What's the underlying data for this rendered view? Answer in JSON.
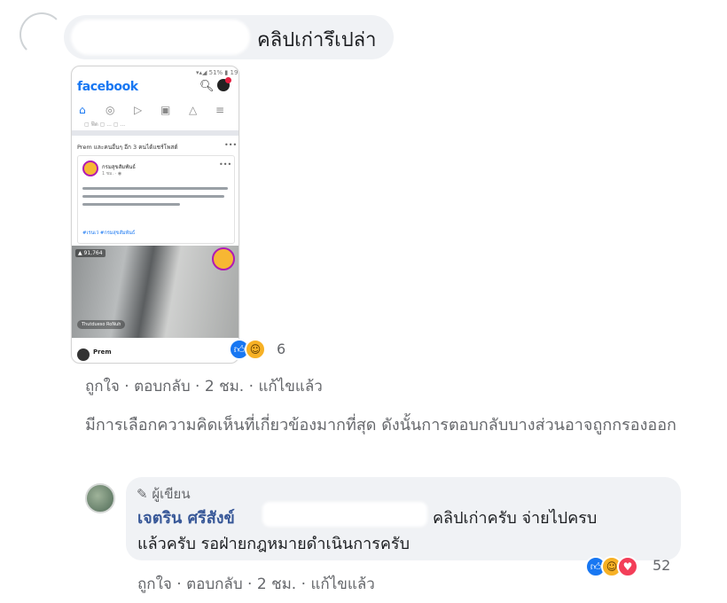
{
  "comment1": {
    "text": "คลิปเก่ารึเปล่า",
    "screenshot": {
      "status": "▾▴◢ 51% ▮ 19",
      "logo": "facebook",
      "sub_text": "▢ ฟีด ▢ ...   ▢ ...",
      "prem_line": "Prem และคนอื่นๆ อีก 3 คนได้แชร์โพสต์",
      "post_name": "กรมสุขสัมพันธ์",
      "post_time": "1 ชม. · ◉",
      "post_link": "#เรนเว่ #กรมสุขสัมพันธ์",
      "video_badge": "▲ 91,764",
      "video_pill": "Thutdueso RoNuh",
      "bottom_name": "Prem"
    },
    "reactions": [
      "like",
      "haha"
    ],
    "reaction_count": "6",
    "actions": {
      "like": "ถูกใจ",
      "reply": "ตอบกลับ",
      "time": "2 ชม.",
      "edited": "แก้ไขแล้ว"
    }
  },
  "notice": "มีการเลือกความคิดเห็นที่เกี่ยวข้องมากที่สุด ดังนั้นการตอบกลับบางส่วนอาจถูกกรองออก",
  "reply": {
    "badge": "ผู้เขียน",
    "author": "เจตริน ศรีสังข์",
    "text_line1": "คลิปเก่าครับ จ่ายไปครบ",
    "text_line2": "แล้วครับ รอฝ่ายกฎหมายดำเนินการครับ",
    "reactions": [
      "like",
      "haha",
      "love"
    ],
    "reaction_count": "52",
    "actions": {
      "like": "ถูกใจ",
      "reply": "ตอบกลับ",
      "time": "2 ชม.",
      "edited": "แก้ไขแล้ว"
    }
  },
  "colors": {
    "bubble": "#f0f2f5",
    "link_blue": "#385898",
    "meta_grey": "#65676b",
    "facebook_blue": "#1877f2"
  },
  "icons": {
    "author_badge": "pencil-icon",
    "like": "like-reaction-icon",
    "haha": "haha-reaction-icon",
    "love": "love-reaction-icon"
  }
}
